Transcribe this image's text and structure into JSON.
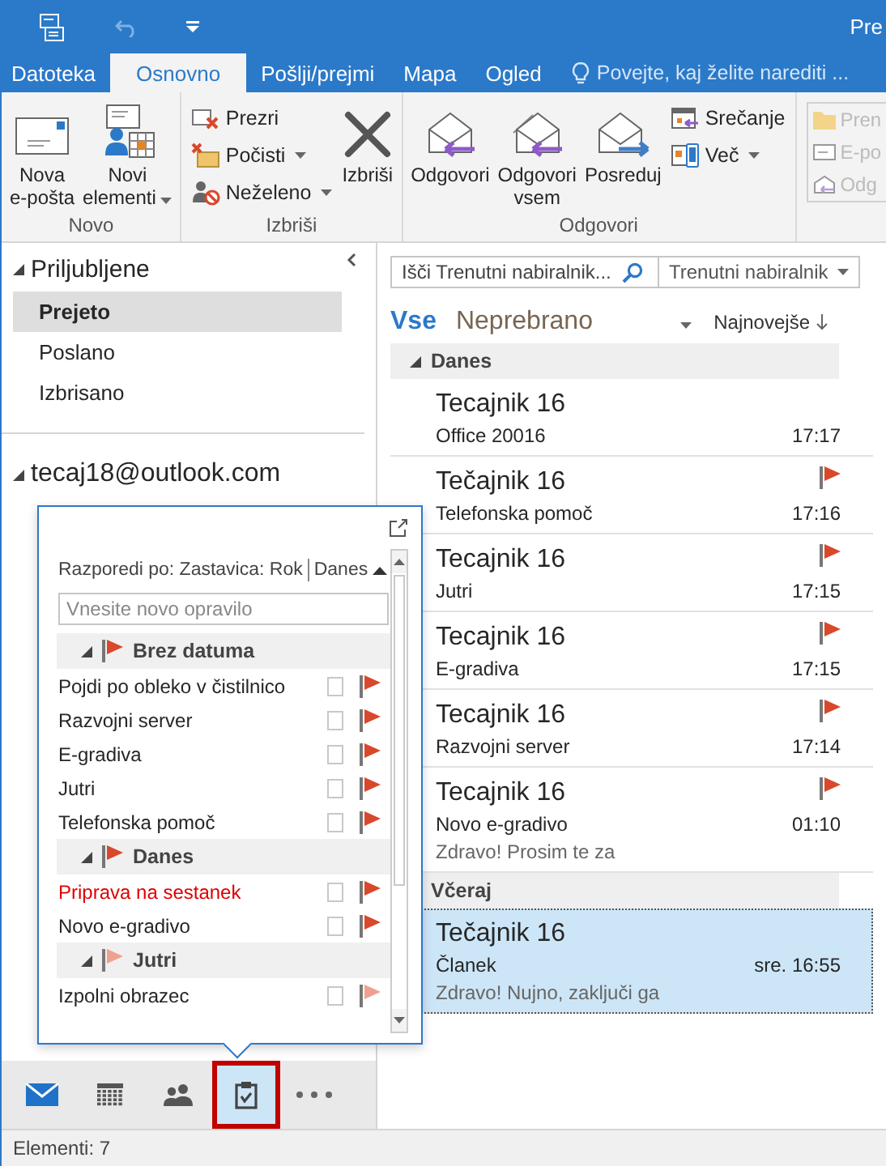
{
  "title_bar": {
    "title": "Pre"
  },
  "tabs": [
    {
      "label": "Datoteka",
      "selected": false
    },
    {
      "label": "Osnovno",
      "selected": true
    },
    {
      "label": "Pošlji/prejmi",
      "selected": false
    },
    {
      "label": "Mapa",
      "selected": false
    },
    {
      "label": "Ogled",
      "selected": false
    }
  ],
  "tell_me": {
    "placeholder": "Povejte, kaj želite narediti ..."
  },
  "ribbon": {
    "groups": [
      {
        "label": "Novo",
        "items": [
          {
            "kind": "large",
            "label": "Nova\ne-pošta",
            "dropdown": false
          },
          {
            "kind": "large",
            "label": "Novi\nelementi",
            "dropdown": true
          }
        ]
      },
      {
        "label": "Izbriši",
        "items": [
          {
            "kind": "stack",
            "buttons": [
              {
                "label": "Prezri",
                "dropdown": false
              },
              {
                "label": "Počisti",
                "dropdown": true
              },
              {
                "label": "Neželeno",
                "dropdown": true
              }
            ]
          },
          {
            "kind": "large",
            "label": "Izbriši",
            "dropdown": false
          }
        ]
      },
      {
        "label": "Odgovori",
        "items": [
          {
            "kind": "large",
            "label": "Odgovori",
            "dropdown": false
          },
          {
            "kind": "large",
            "label": "Odgovori\nvsem",
            "dropdown": false
          },
          {
            "kind": "large",
            "label": "Posreduj",
            "dropdown": false
          },
          {
            "kind": "stack",
            "buttons": [
              {
                "label": "Srečanje",
                "dropdown": false
              },
              {
                "label": "Več",
                "dropdown": true
              }
            ]
          }
        ]
      }
    ]
  },
  "quick_steps": [
    "Pren",
    "E-po",
    "Odg"
  ],
  "folders": {
    "favorites": {
      "label": "Priljubljene",
      "items": [
        {
          "label": "Prejeto",
          "selected": true
        },
        {
          "label": "Poslano",
          "selected": false
        },
        {
          "label": "Izbrisano",
          "selected": false
        }
      ]
    },
    "account": {
      "label": "tecaj18@outlook.com"
    }
  },
  "search": {
    "placeholder": "Išči Trenutni nabiralnik...",
    "scope": "Trenutni nabiralnik"
  },
  "filters": [
    {
      "label": "Vse",
      "selected": true
    },
    {
      "label": "Neprebrano",
      "selected": false
    }
  ],
  "sort": "Najnovejše",
  "message_groups": [
    {
      "label": "Danes",
      "messages": [
        {
          "sender": "Tecajnik 16",
          "subject": "Office 20016",
          "time": "17:17",
          "flagged": false,
          "selected": false
        },
        {
          "sender": "Tečajnik 16",
          "subject": "Telefonska pomoč",
          "time": "17:16",
          "flagged": true,
          "selected": false
        },
        {
          "sender": "Tecajnik 16",
          "subject": "Jutri",
          "time": "17:15",
          "flagged": true,
          "selected": false
        },
        {
          "sender": "Tecajnik 16",
          "subject": "E-gradiva",
          "time": "17:15",
          "flagged": true,
          "selected": false
        },
        {
          "sender": "Tecajnik 16",
          "subject": "Razvojni server",
          "time": "17:14",
          "flagged": true,
          "selected": false
        },
        {
          "sender": "Tecajnik 16",
          "subject": "Novo e-gradivo",
          "time": "01:10",
          "flagged": true,
          "selected": false,
          "preview": "Zdravo!  Prosim te za"
        }
      ]
    },
    {
      "label": "Včeraj",
      "messages": [
        {
          "sender": "Tečajnik 16",
          "subject": "Članek",
          "time": "sre. 16:55",
          "flagged": false,
          "selected": true,
          "preview": "Zdravo!  Nujno, zaključi ga"
        }
      ]
    }
  ],
  "tasks_peek": {
    "arrange": "Razporedi po: Zastavica: Rok",
    "order": "Danes",
    "new_task": {
      "placeholder": "Vnesite novo opravilo"
    },
    "groups": [
      {
        "label": "Brez datuma",
        "color": "#d9482b",
        "tasks": [
          {
            "title": "Pojdi po obleko v čistilnico",
            "checked": false,
            "overdue": false
          },
          {
            "title": "Razvojni server",
            "checked": false,
            "overdue": false
          },
          {
            "title": "E-gradiva",
            "checked": false,
            "overdue": false
          },
          {
            "title": "Jutri",
            "checked": false,
            "overdue": false
          },
          {
            "title": "Telefonska pomoč",
            "checked": false,
            "overdue": false
          }
        ]
      },
      {
        "label": "Danes",
        "color": "#d9482b",
        "tasks": [
          {
            "title": "Priprava na sestanek",
            "checked": false,
            "overdue": true
          },
          {
            "title": "Novo e-gradivo",
            "checked": false,
            "overdue": false
          }
        ]
      },
      {
        "label": "Jutri",
        "color": "#f0a08e",
        "tasks": [
          {
            "title": "Izpolni obrazec",
            "checked": false,
            "overdue": false
          }
        ]
      }
    ]
  },
  "nav": [
    {
      "selected": false
    },
    {
      "selected": false
    },
    {
      "selected": false
    },
    {
      "selected": true
    },
    {
      "selected": false
    }
  ],
  "status_bar": {
    "text": "Elementi: 7"
  }
}
